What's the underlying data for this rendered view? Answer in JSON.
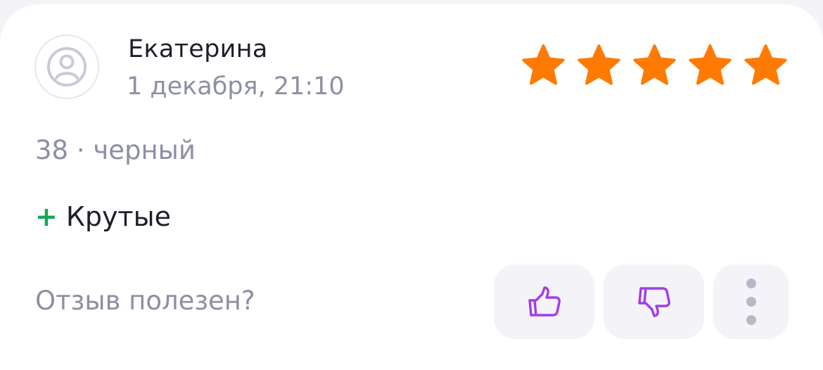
{
  "review": {
    "author": "Екатерина",
    "date": "1 декабря, 21:10",
    "rating": 5,
    "rating_max": 5,
    "variant": "38 · черный",
    "pros_sign": "+",
    "pros": "Крутые"
  },
  "feedback": {
    "question": "Отзыв полезен?",
    "like_icon": "thumbs-up-icon",
    "dislike_icon": "thumbs-down-icon",
    "more_icon": "more-vertical-icon"
  },
  "colors": {
    "star": "#ff7a00",
    "accent_icon": "#a23ce6",
    "pros_sign": "#13a856",
    "muted_text": "#8d8fa3",
    "primary_text": "#1f1f2b",
    "button_bg": "#f3f3f8"
  }
}
